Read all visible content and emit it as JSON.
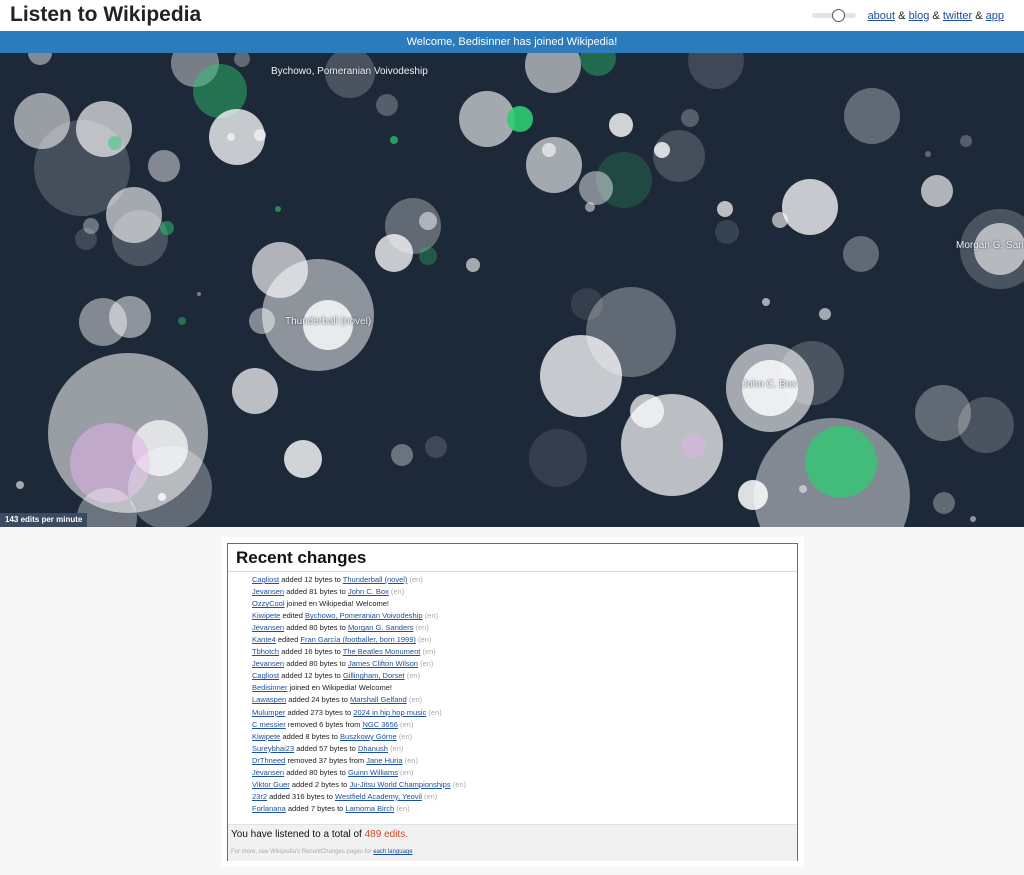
{
  "header": {
    "title": "Listen to Wikipedia",
    "links": [
      {
        "label": "about"
      },
      {
        "label": "blog"
      },
      {
        "label": "twitter"
      },
      {
        "label": "app"
      }
    ],
    "link_separator": "&"
  },
  "banner": {
    "text": "Welcome, Bedisinner has joined Wikipedia!"
  },
  "visualization": {
    "labels": [
      {
        "text": "Bychowo, Pomeranian Voivodeship"
      },
      {
        "text": "Morgan G. Sanders"
      },
      {
        "text": "Thunderball (novel)"
      },
      {
        "text": "John C. Box"
      }
    ],
    "edits_per_minute": "143 edits per minute",
    "colors": {
      "background": "#1d2939",
      "edit_bubble": "#ffffff",
      "new_user_bubble": "#2ecc71",
      "anonymous_bubble": "#e0b3e8"
    }
  },
  "recent_changes": {
    "title": "Recent changes",
    "items": [
      {
        "user": "Cagliost",
        "action": "added 12 bytes to",
        "page": "Thunderball (novel)",
        "lang": "(en)"
      },
      {
        "user": "Jevansen",
        "action": "added 81 bytes to",
        "page": "John C. Box",
        "lang": "(en)"
      },
      {
        "user": "OzzyCool",
        "action": "joined en Wikipedia! Welcome!",
        "page": "",
        "lang": ""
      },
      {
        "user": "Kiwipete",
        "action": "edited",
        "page": "Bychowo, Pomeranian Voivodeship",
        "lang": "(en)"
      },
      {
        "user": "Jevansen",
        "action": "added 80 bytes to",
        "page": "Morgan G. Sanders",
        "lang": "(en)"
      },
      {
        "user": "Kante4",
        "action": "edited",
        "page": "Fran García (footballer, born 1999)",
        "lang": "(en)"
      },
      {
        "user": "Tbhotch",
        "action": "added 16 bytes to",
        "page": "The Beatles Monument",
        "lang": "(en)"
      },
      {
        "user": "Jevansen",
        "action": "added 80 bytes to",
        "page": "James Clifton Wilson",
        "lang": "(en)"
      },
      {
        "user": "Cagliost",
        "action": "added 12 bytes to",
        "page": "Gillingham, Dorset",
        "lang": "(en)"
      },
      {
        "user": "Bedisinner",
        "action": "joined en Wikipedia! Welcome!",
        "page": "",
        "lang": ""
      },
      {
        "user": "Lawaspen",
        "action": "added 24 bytes to",
        "page": "Marshall Gelfand",
        "lang": "(en)"
      },
      {
        "user": "Mulumper",
        "action": "added 273 bytes to",
        "page": "2024 in hip hop music",
        "lang": "(en)"
      },
      {
        "user": "C messier",
        "action": "removed 6 bytes from",
        "page": "NGC 3656",
        "lang": "(en)"
      },
      {
        "user": "Kiwipete",
        "action": "added 8 bytes to",
        "page": "Buszkowy Górne",
        "lang": "(en)"
      },
      {
        "user": "Sureybhai23",
        "action": "added 57 bytes to",
        "page": "Dhanush",
        "lang": "(en)"
      },
      {
        "user": "DrThneed",
        "action": "removed 37 bytes from",
        "page": "Jane Huria",
        "lang": "(en)"
      },
      {
        "user": "Jevansen",
        "action": "added 80 bytes to",
        "page": "Guinn Williams",
        "lang": "(en)"
      },
      {
        "user": "Viktor Guer",
        "action": "added 2 bytes to",
        "page": "Ju-Jitsu World Championships",
        "lang": "(en)"
      },
      {
        "user": "23r2",
        "action": "added 316 bytes to",
        "page": "Westfield Academy, Yeovil",
        "lang": "(en)"
      },
      {
        "user": "Forlanana",
        "action": "added 7 bytes to",
        "page": "Lamorna Birch",
        "lang": "(en)"
      }
    ],
    "total_prefix": "You have listened to a total of",
    "total_count": "489 edits.",
    "more_text": "For more, see Wikipedia's RecentChanges pages for",
    "more_link": "each language"
  }
}
